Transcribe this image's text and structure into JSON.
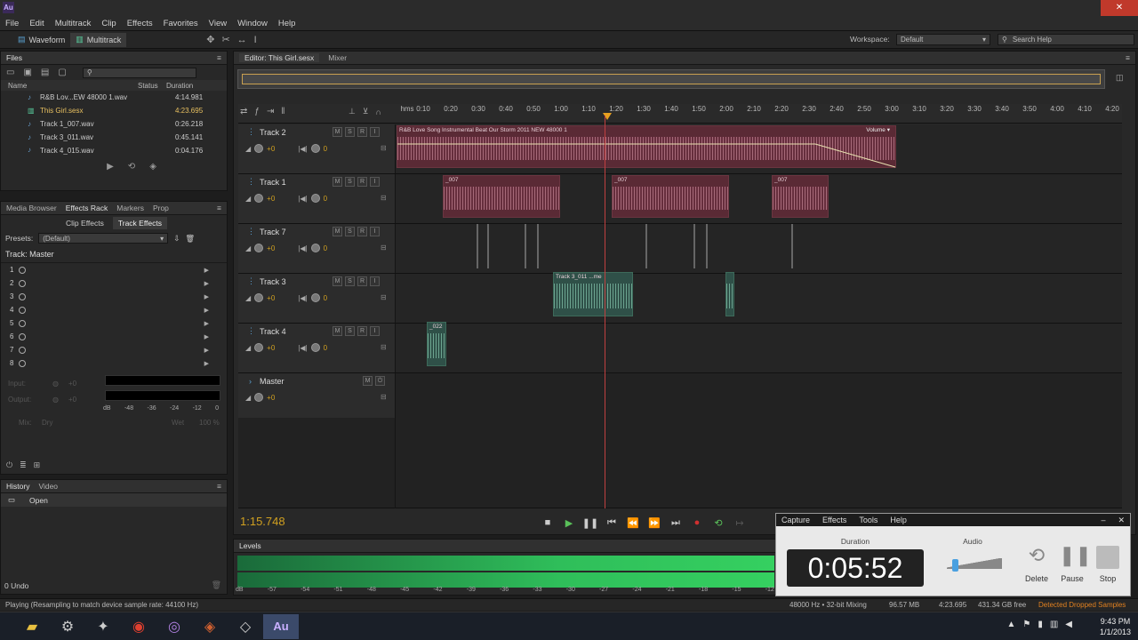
{
  "app": {
    "logo": "Au",
    "close": "✕"
  },
  "menu": [
    "File",
    "Edit",
    "Multitrack",
    "Clip",
    "Effects",
    "Favorites",
    "View",
    "Window",
    "Help"
  ],
  "toolbar": {
    "waveform": "Waveform",
    "multitrack": "Multitrack",
    "workspace_label": "Workspace:",
    "workspace_value": "Default",
    "search_placeholder": "Search Help"
  },
  "files": {
    "title": "Files",
    "col_name": "Name",
    "col_status": "Status",
    "col_duration": "Duration",
    "rows": [
      {
        "name": "R&B Lov...EW 48000 1.wav",
        "duration": "4:14.981"
      },
      {
        "name": "This Girl.sesx",
        "duration": "4:23.695"
      },
      {
        "name": "Track 1_007.wav",
        "duration": "0:26.218"
      },
      {
        "name": "Track 3_011.wav",
        "duration": "0:45.141"
      },
      {
        "name": "Track 4_015.wav",
        "duration": "0:04.176"
      }
    ]
  },
  "effects": {
    "tabs": [
      "Media Browser",
      "Effects Rack",
      "Markers",
      "Prop"
    ],
    "subtabs": [
      "Clip Effects",
      "Track Effects"
    ],
    "presets_label": "Presets:",
    "presets_value": "(Default)",
    "track_label": "Track: Master",
    "slots": [
      "1",
      "2",
      "3",
      "4",
      "5",
      "6",
      "7",
      "8"
    ],
    "input": "Input:",
    "output": "Output:",
    "in_val": "+0",
    "out_val": "+0",
    "meter_ticks": [
      "dB",
      "-48",
      "-36",
      "-24",
      "-12",
      "0"
    ],
    "mix": "Mix:",
    "dry": "Dry",
    "wet": "Wet",
    "pct": "100 %"
  },
  "history": {
    "tabs": [
      "History",
      "Video"
    ],
    "item": "Open",
    "undo": "0 Undo"
  },
  "editor": {
    "tab_editor": "Editor: This Girl.sesx",
    "tab_mixer": "Mixer",
    "ruler_start": "hms",
    "ruler": [
      "0:10",
      "0:20",
      "0:30",
      "0:40",
      "0:50",
      "1:00",
      "1:10",
      "1:20",
      "1:30",
      "1:40",
      "1:50",
      "2:00",
      "2:10",
      "2:20",
      "2:30",
      "2:40",
      "2:50",
      "3:00",
      "3:10",
      "3:20",
      "3:30",
      "3:40",
      "3:50",
      "4:00",
      "4:10",
      "4:20"
    ],
    "tracks": [
      {
        "name": "Track 2",
        "vol": "+0",
        "pan": "0"
      },
      {
        "name": "Track 1",
        "vol": "+0",
        "pan": "0"
      },
      {
        "name": "Track 7",
        "vol": "+0",
        "pan": "0"
      },
      {
        "name": "Track 3",
        "vol": "+0",
        "pan": "0"
      },
      {
        "name": "Track 4",
        "vol": "+0",
        "pan": "0"
      }
    ],
    "master": {
      "name": "Master",
      "vol": "+0"
    },
    "clip_main": "R&B Love Song Instrumental Beat Our Storm 2011 NEW 48000 1",
    "clip_volume": "Volume",
    "clip_007": "_007",
    "clip_t3": "Track 3_011 ...me",
    "clip_t4": "_022",
    "time": "1:15.748"
  },
  "levels": {
    "title": "Levels",
    "ticks": [
      "dB",
      "-57",
      "-54",
      "-51",
      "-48",
      "-45",
      "-42",
      "-39",
      "-36",
      "-33",
      "-30",
      "-27",
      "-24",
      "-21",
      "-18",
      "-15",
      "-12"
    ]
  },
  "capture": {
    "menu": [
      "Capture",
      "Effects",
      "Tools",
      "Help"
    ],
    "duration_label": "Duration",
    "duration": "0:05:52",
    "audio_label": "Audio",
    "delete": "Delete",
    "pause": "Pause",
    "stop": "Stop"
  },
  "status": {
    "left": "Playing (Resampling to match device sample rate: 44100 Hz)",
    "rate": "48000 Hz • 32-bit Mixing",
    "mem": "96.57 MB",
    "dur": "4:23.695",
    "free": "431.34 GB free",
    "warn": "Detected Dropped Samples"
  },
  "taskbar": {
    "time": "9:43 PM",
    "date": "1/1/2013"
  }
}
